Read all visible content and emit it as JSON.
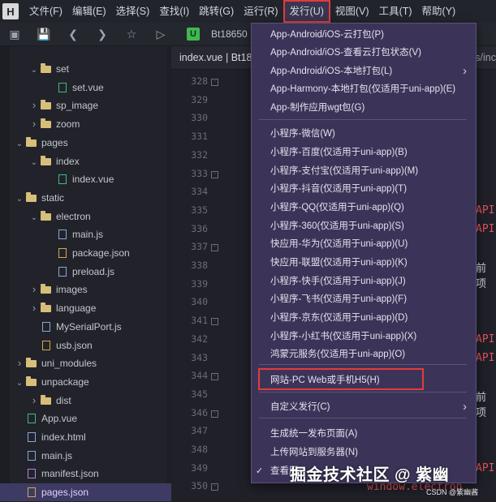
{
  "menubar": {
    "logo": "H",
    "items": [
      "文件(F)",
      "编辑(E)",
      "选择(S)",
      "查找(I)",
      "跳转(G)",
      "运行(R)",
      "发行(U)",
      "视图(V)",
      "工具(T)",
      "帮助(Y)"
    ]
  },
  "toolbar": {
    "badge": "U",
    "path": "Bt18650"
  },
  "sidebar": {
    "rows": [
      {
        "label": "set",
        "type": "folder",
        "open": true
      },
      {
        "label": "set.vue",
        "type": "vue"
      },
      {
        "label": "sp_image",
        "type": "folder",
        "open": false
      },
      {
        "label": "zoom",
        "type": "folder",
        "open": false
      },
      {
        "label": "pages",
        "type": "folder",
        "open": true
      },
      {
        "label": "index",
        "type": "folder",
        "open": true
      },
      {
        "label": "index.vue",
        "type": "vue"
      },
      {
        "label": "static",
        "type": "folder",
        "open": true
      },
      {
        "label": "electron",
        "type": "folder",
        "open": true
      },
      {
        "label": "main.js",
        "type": "js"
      },
      {
        "label": "package.json",
        "type": "json"
      },
      {
        "label": "preload.js",
        "type": "js"
      },
      {
        "label": "images",
        "type": "folder",
        "open": false
      },
      {
        "label": "language",
        "type": "folder",
        "open": false
      },
      {
        "label": "MySerialPort.js",
        "type": "js"
      },
      {
        "label": "usb.json",
        "type": "json"
      },
      {
        "label": "uni_modules",
        "type": "folder",
        "open": false
      },
      {
        "label": "unpackage",
        "type": "folder",
        "open": true
      },
      {
        "label": "dist",
        "type": "folder",
        "open": false
      },
      {
        "label": "App.vue",
        "type": "vue"
      },
      {
        "label": "index.html",
        "type": "js"
      },
      {
        "label": "main.js",
        "type": "js"
      },
      {
        "label": "manifest.json",
        "type": "manifest"
      },
      {
        "label": "pages.json",
        "type": "json"
      }
    ]
  },
  "editor": {
    "tab": "index.vue | Bt18",
    "tab_right": "s/inc",
    "line_numbers": [
      "328",
      "329",
      "330",
      "331",
      "332",
      "333",
      "334",
      "335",
      "336",
      "337",
      "338",
      "339",
      "340",
      "341",
      "342",
      "343",
      "344",
      "345",
      "346",
      "347",
      "348",
      "349",
      "350"
    ],
    "code_fragments": {
      "api1": "API",
      "api2": "API",
      "qian1": "前项",
      "api3": "API",
      "api4": "API",
      "qian2": "前项",
      "api5": "API",
      "window_electron": "window.electron"
    }
  },
  "dropdown": {
    "items": [
      {
        "label": "App-Android/iOS-云打包(P)"
      },
      {
        "label": "App-Android/iOS-查看云打包状态(V)"
      },
      {
        "label": "App-Android/iOS-本地打包(L)",
        "submenu": true
      },
      {
        "label": "App-Harmony-本地打包(仅适用于uni-app)(E)"
      },
      {
        "label": "App-制作应用wgt包(G)"
      },
      {
        "label": "小程序-微信(W)"
      },
      {
        "label": "小程序-百度(仅适用于uni-app)(B)"
      },
      {
        "label": "小程序-支付宝(仅适用于uni-app)(M)"
      },
      {
        "label": "小程序-抖音(仅适用于uni-app)(T)"
      },
      {
        "label": "小程序-QQ(仅适用于uni-app)(Q)"
      },
      {
        "label": "小程序-360(仅适用于uni-app)(S)"
      },
      {
        "label": "快应用-华为(仅适用于uni-app)(U)"
      },
      {
        "label": "快应用-联盟(仅适用于uni-app)(K)"
      },
      {
        "label": "小程序-快手(仅适用于uni-app)(J)"
      },
      {
        "label": "小程序-飞书(仅适用于uni-app)(F)"
      },
      {
        "label": "小程序-京东(仅适用于uni-app)(D)"
      },
      {
        "label": "小程序-小红书(仅适用于uni-app)(X)"
      },
      {
        "label": "鸿蒙元服务(仅适用于uni-app)(O)"
      },
      {
        "label": "网站-PC Web或手机H5(H)"
      },
      {
        "label": "自定义发行(C)",
        "submenu": true
      },
      {
        "label": "生成统一发布页面(A)"
      },
      {
        "label": "上传网站到服务器(N)"
      },
      {
        "label": "查看服",
        "checked": true
      }
    ]
  },
  "watermark": "掘金技术社区 @ 紫幽",
  "csdn": "CSDN @紫幽酱",
  "colors": {
    "highlight": "#e23b3b",
    "menu_bg": "#3c3458",
    "selected_row": "#3d3b63"
  }
}
